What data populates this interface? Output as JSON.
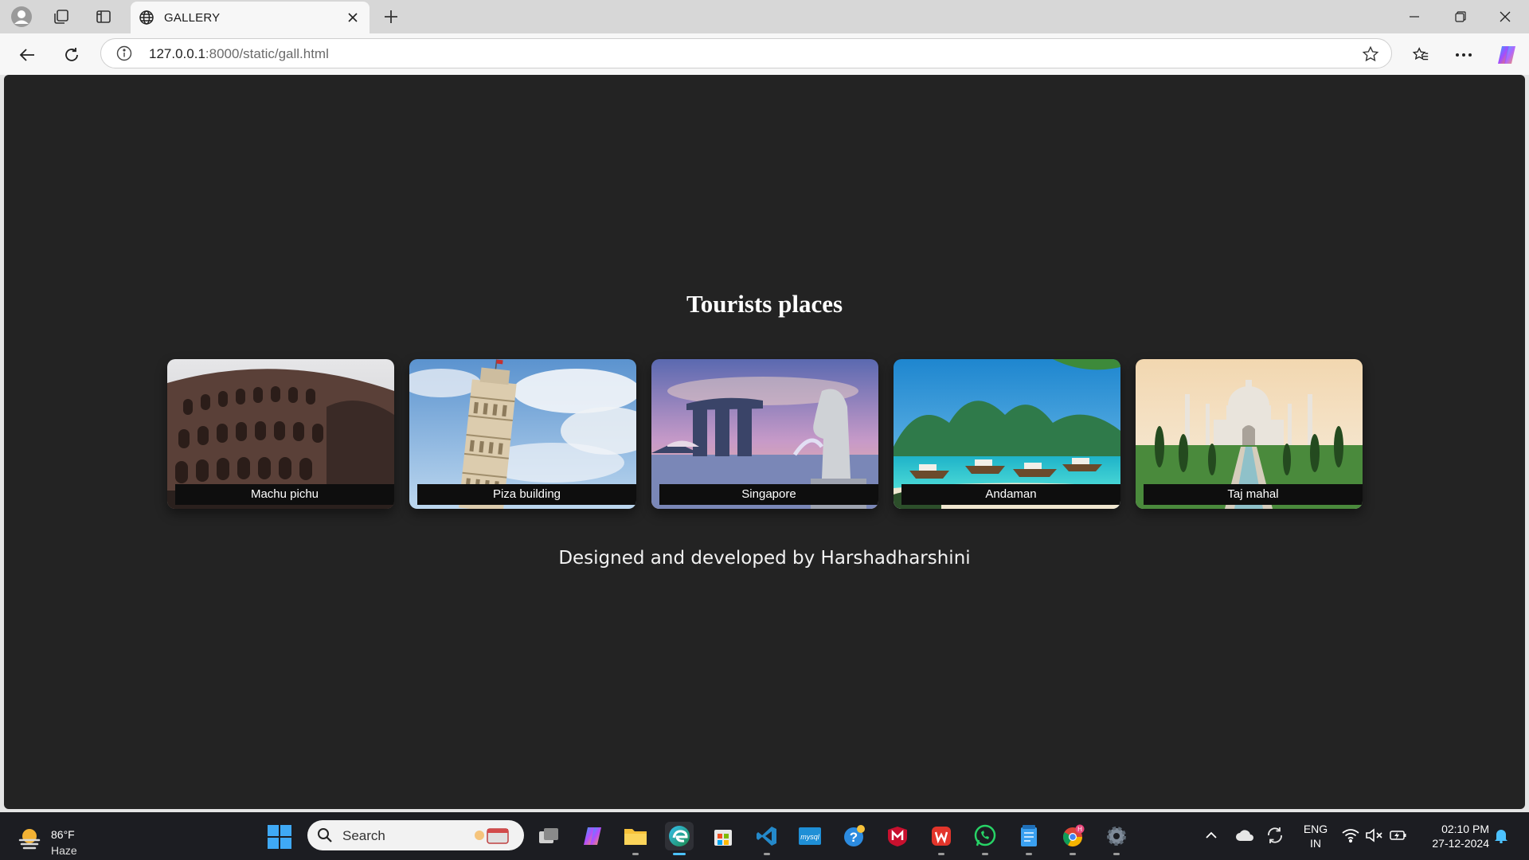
{
  "browser": {
    "tab_title": "GALLERY",
    "url_host": "127.0.0.1",
    "url_rest": ":8000/static/gall.html"
  },
  "page": {
    "title": "Tourists places",
    "cards": [
      {
        "label": "Machu pichu",
        "image": "colosseum-photo"
      },
      {
        "label": "Piza building",
        "image": "leaning-tower-photo"
      },
      {
        "label": "Singapore",
        "image": "marina-bay-merlion-photo"
      },
      {
        "label": "Andaman",
        "image": "tropical-beach-boats-photo"
      },
      {
        "label": "Taj mahal",
        "image": "taj-mahal-photo"
      }
    ],
    "credit": "Designed and developed by Harshadharshini",
    "background_color": "#232323"
  },
  "taskbar": {
    "weather_temp": "86°F",
    "weather_cond": "Haze",
    "search_placeholder": "Search",
    "apps": [
      "task-view",
      "copilot",
      "file-explorer",
      "edge",
      "microsoft-store",
      "vs-code",
      "mysql-workbench",
      "help",
      "mcafee",
      "wps-office",
      "whatsapp",
      "notepad",
      "chrome",
      "settings"
    ],
    "lang_line1": "ENG",
    "lang_line2": "IN",
    "time": "02:10 PM",
    "date": "27-12-2024"
  }
}
